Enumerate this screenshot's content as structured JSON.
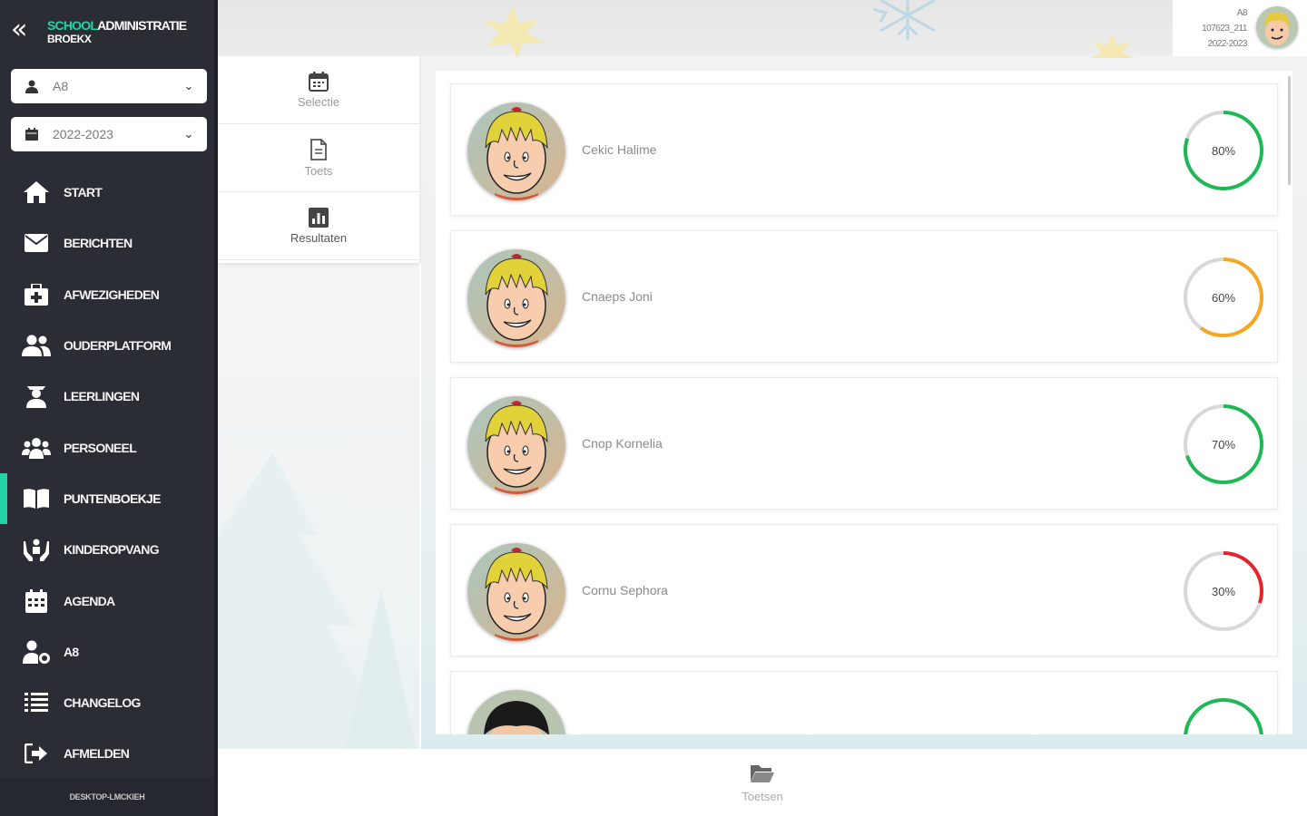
{
  "brand": {
    "accent": "SCHOOL",
    "main": "ADMINISTRATIE",
    "sub": "BROEKX",
    "accent_color": "#22d3a6"
  },
  "selects": {
    "user": {
      "value": "A8",
      "icon": "user-icon"
    },
    "year": {
      "value": "2022-2023",
      "icon": "calendar-icon"
    }
  },
  "nav": {
    "items": [
      {
        "label": "START",
        "icon": "home-icon"
      },
      {
        "label": "BERICHTEN",
        "icon": "envelope-icon"
      },
      {
        "label": "AFWEZIGHEDEN",
        "icon": "medkit-icon"
      },
      {
        "label": "OUDERPLATFORM",
        "icon": "users-icon"
      },
      {
        "label": "LEERLINGEN",
        "icon": "student-icon"
      },
      {
        "label": "PERSONEEL",
        "icon": "staff-icon"
      },
      {
        "label": "PUNTENBOEKJE",
        "icon": "book-icon",
        "active": true
      },
      {
        "label": "KINDEROPVANG",
        "icon": "hands-icon"
      },
      {
        "label": "AGENDA",
        "icon": "agenda-icon"
      },
      {
        "label": "A8",
        "icon": "user-cog-icon"
      },
      {
        "label": "CHANGELOG",
        "icon": "list-icon"
      },
      {
        "label": "AFMELDEN",
        "icon": "sign-out-icon"
      }
    ],
    "device": "DESKTOP-LMCKIEH"
  },
  "user": {
    "name": "A8",
    "code": "107623_211",
    "year": "2022-2023"
  },
  "tabs": [
    {
      "label": "Selectie",
      "icon": "calendar-icon"
    },
    {
      "label": "Toets",
      "icon": "file-icon"
    },
    {
      "label": "Resultaten",
      "icon": "chart-icon",
      "active": true
    }
  ],
  "results": [
    {
      "name": "Cekic Halime",
      "percent": 80,
      "label": "80%",
      "color": "#1db954"
    },
    {
      "name": "Cnaeps Joni",
      "percent": 60,
      "label": "60%",
      "color": "#f5a623"
    },
    {
      "name": "Cnop Kornelia",
      "percent": 70,
      "label": "70%",
      "color": "#1db954"
    },
    {
      "name": "Cornu Sephora",
      "percent": 30,
      "label": "30%",
      "color": "#e8222b"
    },
    {
      "name": "",
      "percent": 100,
      "label": "",
      "color": "#1db954"
    }
  ],
  "bottom": {
    "label": "Toetsen",
    "icon": "folder-icon"
  }
}
